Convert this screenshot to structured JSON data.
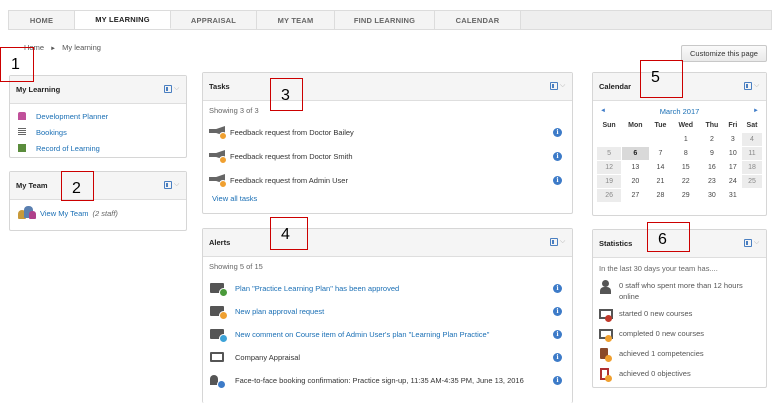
{
  "nav": {
    "tabs": [
      {
        "label": "HOME",
        "active": false
      },
      {
        "label": "MY LEARNING",
        "active": true
      },
      {
        "label": "APPRAISAL",
        "active": false
      },
      {
        "label": "MY TEAM",
        "active": false
      },
      {
        "label": "FIND LEARNING",
        "active": false
      },
      {
        "label": "CALENDAR",
        "active": false
      }
    ]
  },
  "breadcrumb": {
    "home": "Home",
    "separator": "►",
    "current": "My learning"
  },
  "customize_label": "Customize this page",
  "annotations": [
    "1",
    "2",
    "3",
    "4",
    "5",
    "6"
  ],
  "my_learning": {
    "title": "My Learning",
    "items": [
      {
        "label": "Development Planner",
        "icon": "planner-icon",
        "color": "#c0509a"
      },
      {
        "label": "Bookings",
        "icon": "bookings-icon",
        "color": "#666666"
      },
      {
        "label": "Record of Learning",
        "icon": "record-icon",
        "color": "#5a8c3c"
      }
    ]
  },
  "my_team": {
    "title": "My Team",
    "link_label": "View My Team",
    "count_label": "(2 staff)"
  },
  "tasks": {
    "title": "Tasks",
    "showing": "Showing 3 of 3",
    "items": [
      "Feedback request from Doctor Bailey",
      "Feedback request from Doctor Smith",
      "Feedback request from Admin User"
    ],
    "view_all": "View all tasks"
  },
  "alerts": {
    "title": "Alerts",
    "showing": "Showing 5 of 15",
    "items": [
      {
        "text": "Plan \"Practice Learning Plan\" has been approved",
        "link": true,
        "badge_color": "#4a9a3a"
      },
      {
        "text": "New plan approval request",
        "link": true,
        "badge_color": "#f0a030"
      },
      {
        "text": "New comment on Course item of Admin User's plan \"Learning Plan Practice\"",
        "link": true,
        "badge_color": "#3da3d8"
      },
      {
        "text": "Company Appraisal",
        "link": false,
        "badge_color": ""
      },
      {
        "text": "Face-to-face booking confirmation: Practice sign-up, 11:35 AM-4:35 PM, June 13, 2016",
        "link": false,
        "badge_color": "#3d7bc8"
      }
    ]
  },
  "calendar": {
    "title": "Calendar",
    "month": "March 2017",
    "prev": "◄",
    "next": "►",
    "days": [
      "Sun",
      "Mon",
      "Tue",
      "Wed",
      "Thu",
      "Fri",
      "Sat"
    ],
    "weeks": [
      [
        "",
        "",
        "",
        "1",
        "2",
        "3",
        "4"
      ],
      [
        "5",
        "6",
        "7",
        "8",
        "9",
        "10",
        "11"
      ],
      [
        "12",
        "13",
        "14",
        "15",
        "16",
        "17",
        "18"
      ],
      [
        "19",
        "20",
        "21",
        "22",
        "23",
        "24",
        "25"
      ],
      [
        "26",
        "27",
        "28",
        "29",
        "30",
        "31",
        ""
      ]
    ],
    "today": "6"
  },
  "statistics": {
    "title": "Statistics",
    "intro": "In the last 30 days your team has....",
    "items": [
      "0 staff who spent more than 12 hours online",
      "started 0 new courses",
      "completed 0 new courses",
      "achieved 1 competencies",
      "achieved 0 objectives"
    ]
  },
  "colors": {
    "link": "#1a6fb5",
    "accent": "#3d7bc8",
    "annotation": "#cc0000"
  }
}
